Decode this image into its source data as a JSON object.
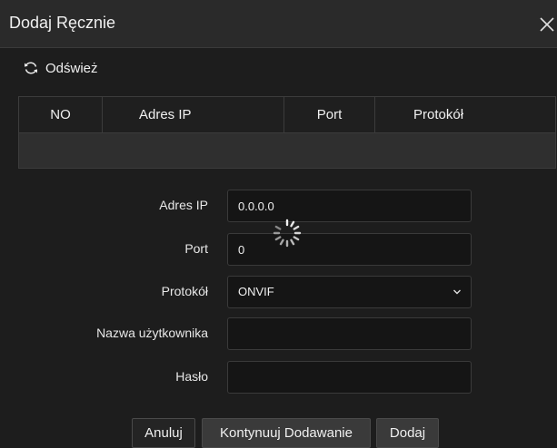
{
  "dialog": {
    "title": "Dodaj Ręcznie"
  },
  "toolbar": {
    "refresh_label": "Odśwież",
    "refresh_icon": "refresh-icon"
  },
  "table": {
    "columns": [
      "NO",
      "Adres IP",
      "Port",
      "Protokół"
    ],
    "rows": []
  },
  "form": {
    "ip": {
      "label": "Adres IP",
      "value": "0.0.0.0"
    },
    "port": {
      "label": "Port",
      "value": "0"
    },
    "protocol": {
      "label": "Protokół",
      "value": "ONVIF"
    },
    "username": {
      "label": "Nazwa użytkownika",
      "value": ""
    },
    "password": {
      "label": "Hasło",
      "value": ""
    }
  },
  "buttons": {
    "cancel": "Anuluj",
    "continue": "Kontynuuj Dodawanie",
    "add": "Dodaj"
  },
  "colors": {
    "background": "#1d1d1d",
    "header": "#2a2a2a",
    "input_bg": "#151515",
    "text": "#f0f0f0"
  }
}
